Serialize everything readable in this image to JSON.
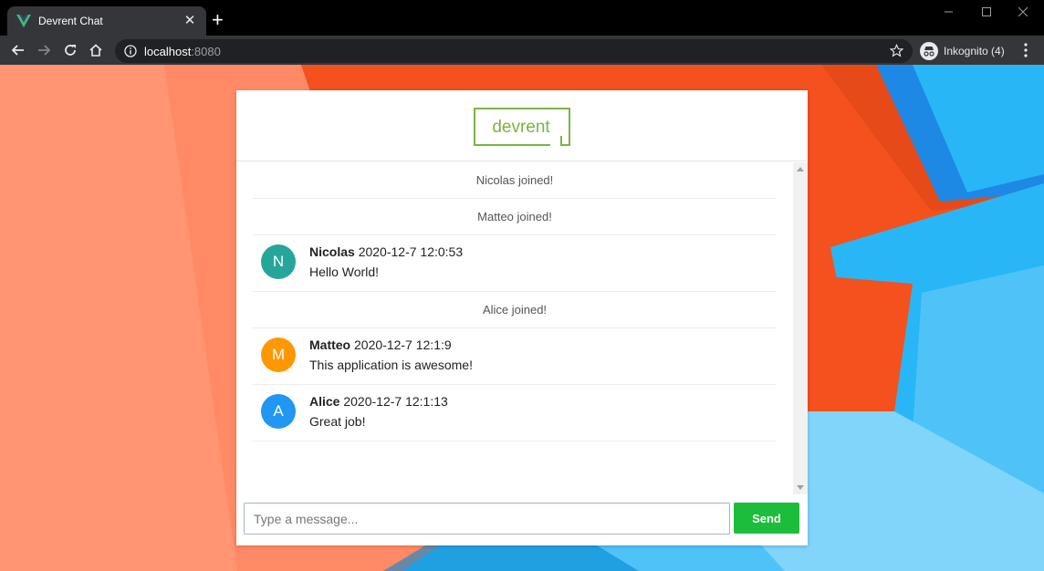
{
  "browser": {
    "tab_title": "Devrent Chat",
    "tab_close": "✕",
    "new_tab": "+",
    "url_host": "localhost",
    "url_port": ":8080",
    "profile_label": "Inkognito (4)"
  },
  "app": {
    "logo_text": "devrent",
    "brand_color": "#7cb342"
  },
  "chat": {
    "joins": {
      "nicolas": "Nicolas joined!",
      "matteo": "Matteo joined!",
      "alice": "Alice joined!"
    },
    "messages": [
      {
        "initial": "N",
        "author": "Nicolas",
        "time": "2020-12-7 12:0:53",
        "text": "Hello World!",
        "avatar_color": "#26a69a"
      },
      {
        "initial": "M",
        "author": "Matteo",
        "time": "2020-12-7 12:1:9",
        "text": "This application is awesome!",
        "avatar_color": "#ff9800"
      },
      {
        "initial": "A",
        "author": "Alice",
        "time": "2020-12-7 12:1:13",
        "text": "Great job!",
        "avatar_color": "#2196f3"
      }
    ]
  },
  "composer": {
    "placeholder": "Type a message...",
    "send_label": "Send"
  }
}
